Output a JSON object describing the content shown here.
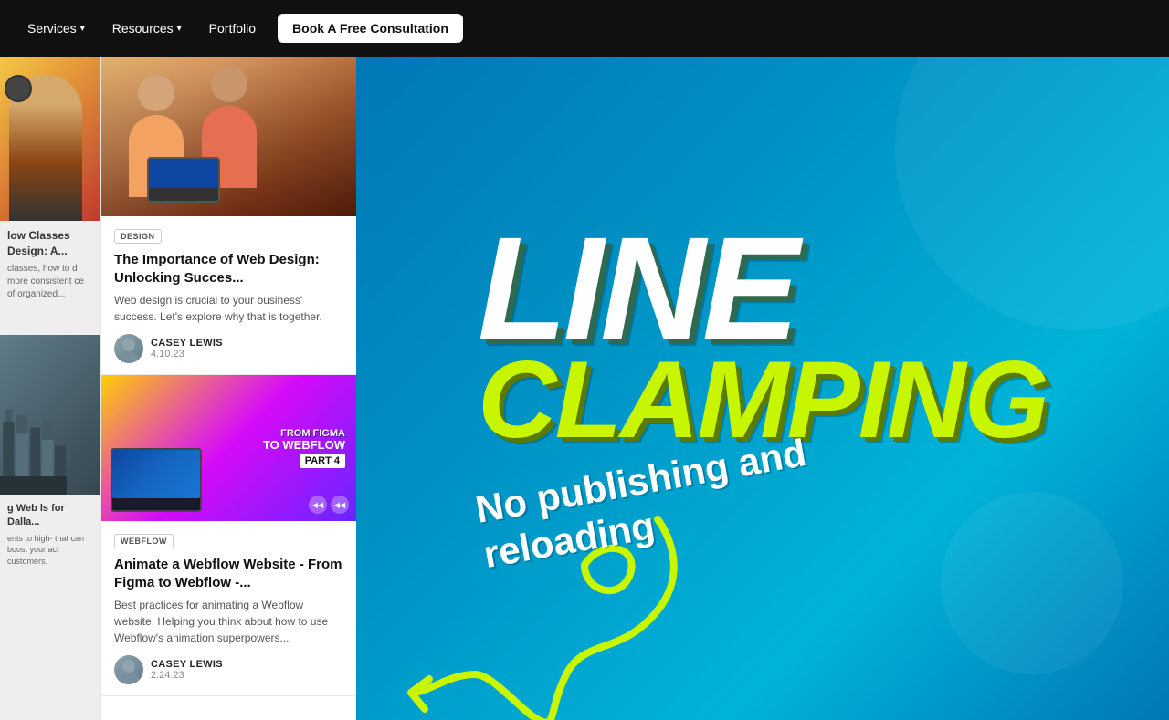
{
  "navbar": {
    "services_label": "Services",
    "resources_label": "Resources",
    "portfolio_label": "Portfolio",
    "cta_label": "Book A Free Consultation"
  },
  "left_panel": {
    "left_col": {
      "top_card": {
        "title": "low Classes Design: A...",
        "excerpt": "classes, how to d more consistent ce of organized..."
      },
      "bottom_card": {
        "title": "g Web ls for Dalla...",
        "excerpt": "ents to high- that can boost your act customers."
      }
    },
    "right_col": {
      "card1": {
        "tag": "DESIGN",
        "title": "The Importance of Web Design: Unlocking Succes...",
        "excerpt": "Web design is crucial to your business' success. Let's explore why that is together.",
        "author": "CASEY LEWIS",
        "date": "4.10.23"
      },
      "card2": {
        "tag": "WEBFLOW",
        "title": "Animate a Webflow Website - From Figma to Webflow -...",
        "excerpt": "Best practices for animating a Webflow website. Helping you think about how to use Webflow's animation superpowers...",
        "author": "CASEY LEWIS",
        "date": "2.24.23",
        "video_from": "FROM FIGMA",
        "video_to": "TO WEBFLOW",
        "video_part": "PART 4"
      }
    }
  },
  "promo": {
    "line": "LINE",
    "clamping": "CLAMPING",
    "subtitle_line1": "No publishing and",
    "subtitle_line2": "reloading"
  }
}
